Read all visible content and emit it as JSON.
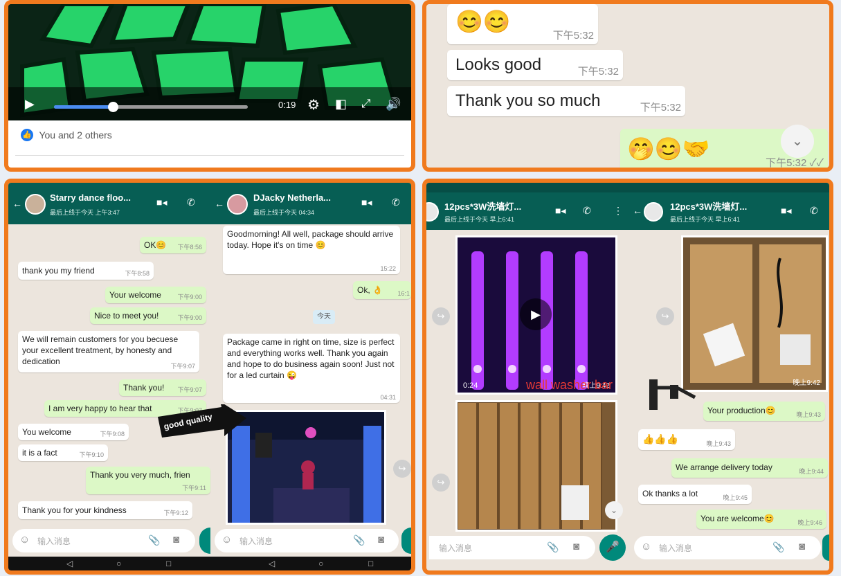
{
  "video_panel": {
    "time": "0:19",
    "reactions": "You and 2 others"
  },
  "chat_top_right": {
    "messages": [
      {
        "emoji": "😊😊",
        "time": "下午5:32"
      },
      {
        "text": "Looks good",
        "time": "下午5:32"
      },
      {
        "text": "Thank you so much",
        "time": "下午5:32"
      },
      {
        "emoji": "🤭😊🤝",
        "time": "下午5:32 ✓✓"
      }
    ]
  },
  "chat_a": {
    "name": "Starry dance floo...",
    "status": "最后上线于今天 上午3:47",
    "messages": [
      {
        "text": "OK😊",
        "time": "下午8:56"
      },
      {
        "text": "thank you my friend",
        "time": "下午8:58"
      },
      {
        "text": "Your welcome",
        "time": "下午9:00"
      },
      {
        "text": "Nice to meet you!",
        "time": "下午9:00"
      },
      {
        "text": "We will remain customers for you becuese your excellent treatment, by honesty and dedication",
        "time": "下午9:07"
      },
      {
        "text": "Thank you!",
        "time": "下午9:07"
      },
      {
        "text": "I am very happy to hear that",
        "time": "下午9:07"
      },
      {
        "text": "You welcome",
        "time": "下午9:08"
      },
      {
        "text": "it is a fact",
        "time": "下午9:10"
      },
      {
        "text": "Thank you very much, frien",
        "time": "下午9:11"
      },
      {
        "text": "Thank you for your kindness",
        "time": "下午9:12"
      }
    ],
    "input_placeholder": "输入消息"
  },
  "chat_b": {
    "name": "DJacky Netherla...",
    "status": "最后上线于今天 04:34",
    "messages": [
      {
        "text": "Goodmorning! All well, package should arrive today. Hope it's on time 😊",
        "time": "15:22"
      },
      {
        "text": "Ok, 👌",
        "time": "16:1"
      },
      {
        "text": "今天"
      },
      {
        "text": "Package came in right on time, size is perfect and everything works well. Thank you again and hope to do business again soon! Just not for a led curtain 😜",
        "time": "04:31"
      }
    ],
    "annotation": "good quality",
    "input_placeholder": "输入消息"
  },
  "chat_c": {
    "name": "12pcs*3W洗墙灯...",
    "status": "最后上线于今天 早上6:41",
    "video_duration": "0:24",
    "video_time": "晚上9:42",
    "overlay_label": "wall washer bar",
    "input_placeholder": "输入消息"
  },
  "chat_d": {
    "name": "12pcs*3W洗墙灯...",
    "status": "最后上线于今天 早上6:41",
    "image_time": "晚上9:42",
    "messages": [
      {
        "text": "Your production😊",
        "time": "晚上9:43"
      },
      {
        "text": "👍👍👍",
        "time": "晚上9:43"
      },
      {
        "text": "We arrange delivery today",
        "time": "晚上9:44"
      },
      {
        "text": "Ok thanks a lot",
        "time": "晚上9:45"
      },
      {
        "text": "You are welcome😊",
        "time": "晚上9:46"
      }
    ],
    "input_placeholder": "输入消息"
  }
}
